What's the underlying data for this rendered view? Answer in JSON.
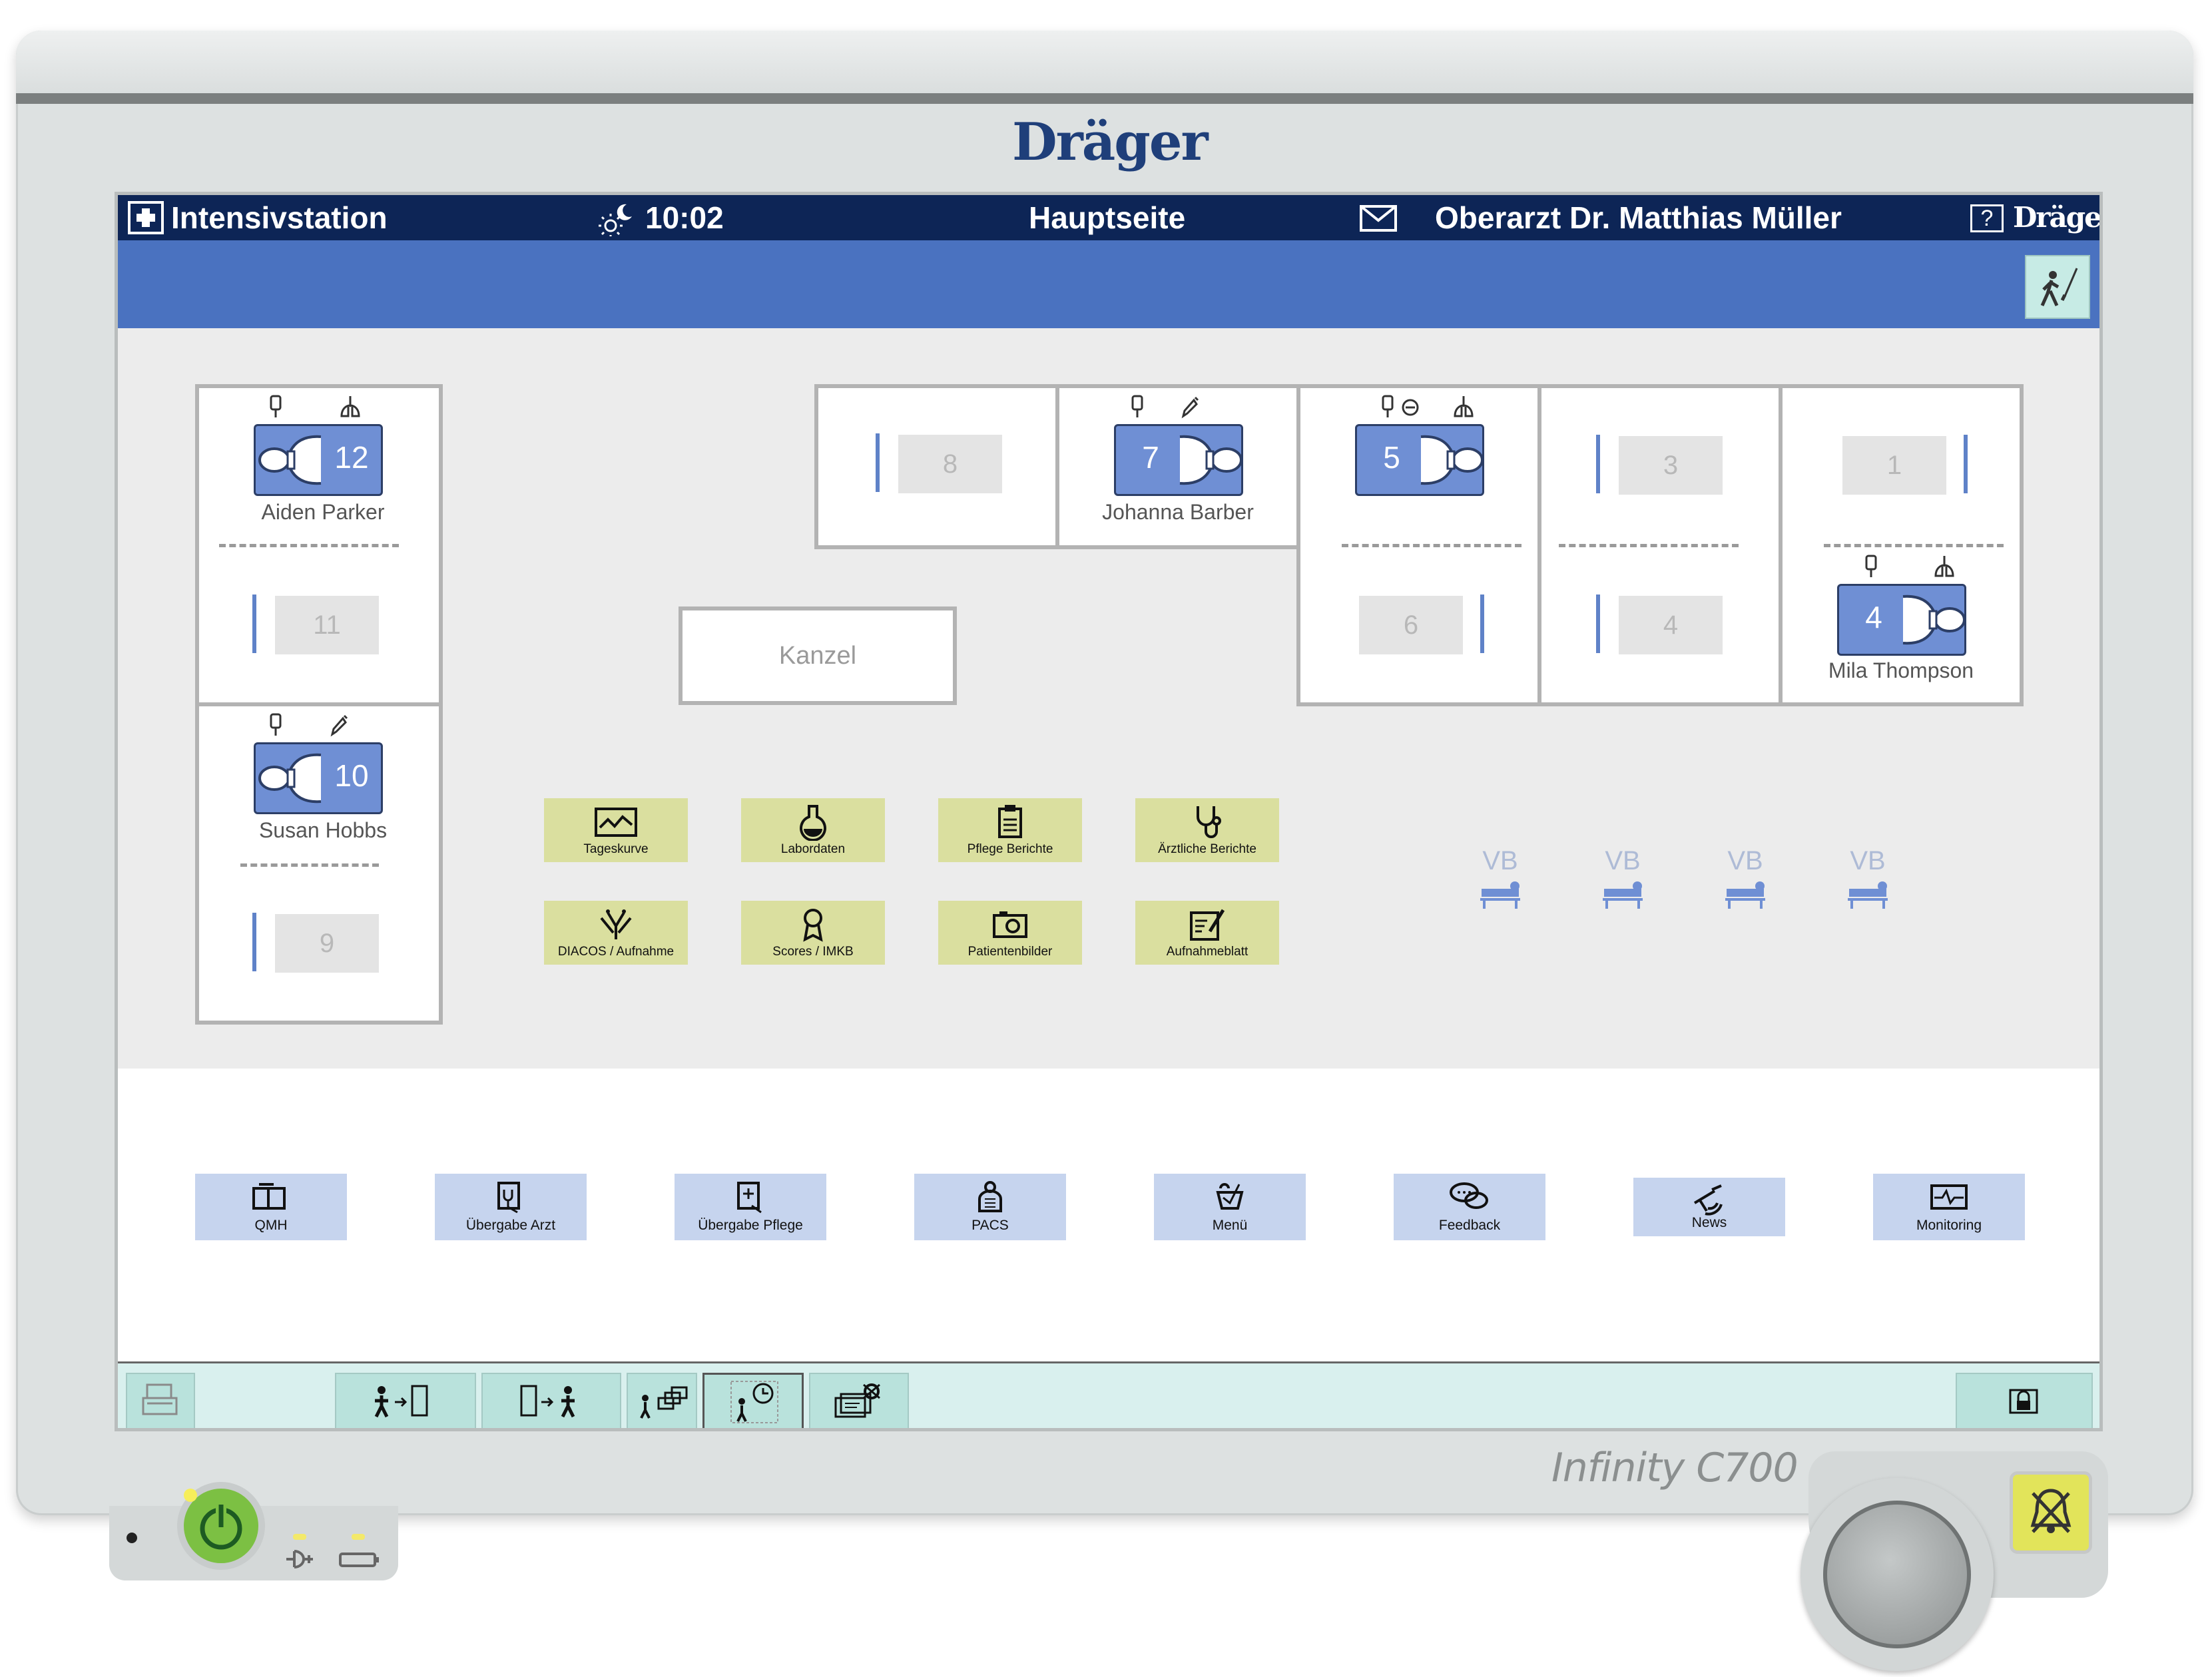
{
  "device": {
    "brand": "Dräger",
    "model": "Infinity C700"
  },
  "topbar": {
    "unit": "Intensivstation",
    "time": "10:02",
    "page_title": "Hauptseite",
    "user": "Oberarzt Dr. Matthias Müller",
    "help": "?",
    "brand": "Dräger"
  },
  "rooms": {
    "left": [
      {
        "upper_bed": "12",
        "upper_patient": "Aiden Parker",
        "lower_bed": "11"
      },
      {
        "upper_bed": "10",
        "upper_patient": "Susan Hobbs",
        "lower_bed": "9"
      }
    ],
    "top": [
      {
        "bed": "8"
      },
      {
        "bed": "7",
        "patient": "Johanna Barber"
      },
      {
        "upper_bed": "5",
        "lower_bed": "6"
      },
      {
        "upper_bed": "3",
        "lower_bed": "4"
      },
      {
        "upper_bed": "1",
        "lower_bed": "4",
        "lower_patient": "Mila Thompson"
      }
    ],
    "kanzel": "Kanzel"
  },
  "green_tiles": [
    {
      "label": "Tageskurve",
      "icon": "chart-icon"
    },
    {
      "label": "Labordaten",
      "icon": "flask-icon"
    },
    {
      "label": "Pflege Berichte",
      "icon": "clipboard-icon"
    },
    {
      "label": "Ärztliche Berichte",
      "icon": "stethoscope-icon"
    },
    {
      "label": "DIACOS / Aufnahme",
      "icon": "diagnosis-icon"
    },
    {
      "label": "Scores / IMKB",
      "icon": "award-icon"
    },
    {
      "label": "Patientenbilder",
      "icon": "camera-icon"
    },
    {
      "label": "Aufnahmeblatt",
      "icon": "form-icon"
    }
  ],
  "vb_slots": [
    "VB",
    "VB",
    "VB",
    "VB"
  ],
  "blue_tiles": [
    {
      "label": "QMH",
      "icon": "book-icon"
    },
    {
      "label": "Übergabe Arzt",
      "icon": "doctor-handover-icon"
    },
    {
      "label": "Übergabe Pflege",
      "icon": "nurse-handover-icon"
    },
    {
      "label": "PACS",
      "icon": "xray-icon"
    },
    {
      "label": "Menü",
      "icon": "menu-icon"
    },
    {
      "label": "Feedback",
      "icon": "speech-bubbles-icon"
    },
    {
      "label": "News",
      "icon": "satellite-icon"
    },
    {
      "label": "Monitoring",
      "icon": "monitor-icon"
    }
  ],
  "colors": {
    "topbar": "#0d2556",
    "bluebar": "#4a72c0",
    "patient_card": "#6f8fd4",
    "green_tile": "#dadf9f",
    "blue_tile": "#c6d4ee",
    "toolbar": "#d9f0ee"
  }
}
